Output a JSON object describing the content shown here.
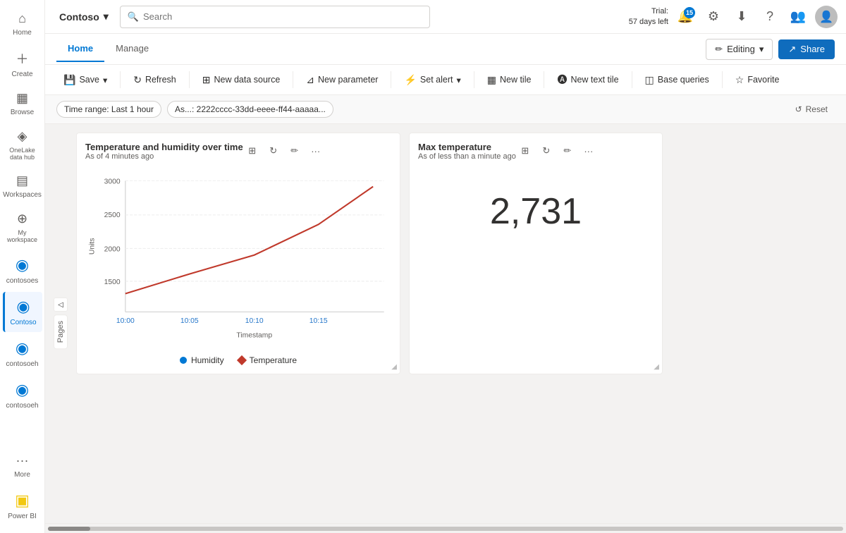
{
  "app": {
    "title": "Contoso",
    "logo_icon": "▾"
  },
  "topbar": {
    "search_placeholder": "Search",
    "trial_line1": "Trial:",
    "trial_line2": "57 days left",
    "notif_count": "15",
    "edit_label": "Editing",
    "share_label": "Share"
  },
  "tabs": {
    "home_label": "Home",
    "manage_label": "Manage"
  },
  "toolbar": {
    "save_label": "Save",
    "refresh_label": "Refresh",
    "new_datasource_label": "New data source",
    "new_parameter_label": "New parameter",
    "set_alert_label": "Set alert",
    "new_tile_label": "New tile",
    "new_text_tile_label": "New text tile",
    "base_queries_label": "Base queries",
    "favorite_label": "Favorite"
  },
  "filters": {
    "time_range": "Time range: Last 1 hour",
    "as_label": "As...: 2222cccc-33dd-eeee-ff44-aaaaa...",
    "reset_label": "Reset"
  },
  "sidebar": {
    "items": [
      {
        "label": "Home",
        "icon": "⌂"
      },
      {
        "label": "Create",
        "icon": "+"
      },
      {
        "label": "Browse",
        "icon": "▦"
      },
      {
        "label": "OneLake data hub",
        "icon": "◈"
      },
      {
        "label": "Workspaces",
        "icon": "▤"
      },
      {
        "label": "My workspace",
        "icon": "⊕"
      },
      {
        "label": "contosoes",
        "icon": "◉"
      },
      {
        "label": "Contoso",
        "icon": "◉"
      },
      {
        "label": "contosoeh",
        "icon": "◉"
      },
      {
        "label": "contosoeh",
        "icon": "◉"
      },
      {
        "label": "More",
        "icon": "···"
      }
    ]
  },
  "pages": {
    "tab_label": "Pages",
    "expand_icon": "◁"
  },
  "cards": [
    {
      "id": "card-temp-humidity",
      "title": "Temperature and humidity over time",
      "subtitle": "As of 4 minutes ago",
      "type": "line-chart",
      "chart": {
        "x_label": "Timestamp",
        "y_label": "Units",
        "x_ticks": [
          "10:00",
          "10:05",
          "10:10",
          "10:15"
        ],
        "y_ticks": [
          "1500",
          "2000",
          "2500",
          "3000"
        ],
        "series": [
          {
            "name": "Temperature",
            "color": "#c0392b",
            "points": [
              [
                0,
                0.85
              ],
              [
                0.25,
                0.72
              ],
              [
                0.5,
                0.5
              ],
              [
                0.75,
                0.27
              ],
              [
                1.0,
                0.05
              ]
            ]
          }
        ]
      },
      "legend": [
        {
          "name": "Humidity",
          "color": "#0078d4",
          "shape": "circle"
        },
        {
          "name": "Temperature",
          "color": "#c0392b",
          "shape": "diamond"
        }
      ]
    },
    {
      "id": "card-max-temp",
      "title": "Max temperature",
      "subtitle": "As of less than a minute ago",
      "type": "big-number",
      "value": "2,731"
    }
  ],
  "bottombar": {
    "powerbi_label": "Power BI"
  }
}
